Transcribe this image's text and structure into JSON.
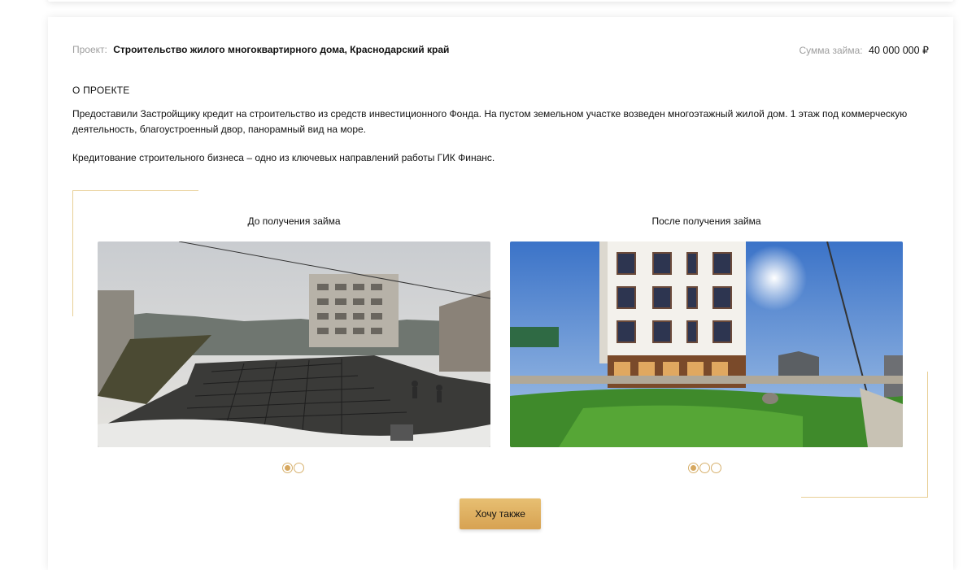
{
  "project": {
    "label": "Проект:",
    "name": "Строительство жилого многоквартирного дома, Краснодарский край"
  },
  "loan": {
    "label": "Сумма займа:",
    "value": "40 000 000 ₽"
  },
  "about": {
    "title": "О ПРОЕКТЕ",
    "paragraph1": "Предоставили Застройщику кредит на строительство из средств инвестиционного Фонда. На пустом земельном участке возведен многоэтажный жилой дом. 1 этаж под коммерческую деятельность, благоустроенный двор, панорамный вид на море.",
    "paragraph2": "Кредитование строительного бизнеса – одно из ключевых направлений работы ГИК Финанс."
  },
  "gallery": {
    "before_title": "До получения займа",
    "after_title": "После получения займа",
    "before_dots": 2,
    "before_active": 1,
    "after_dots": 3,
    "after_active": 1
  },
  "cta": {
    "label": "Хочу также"
  },
  "colors": {
    "accent": "#d7a252",
    "muted_text": "#9e9e9e",
    "decor_line": "#e8cf95"
  }
}
